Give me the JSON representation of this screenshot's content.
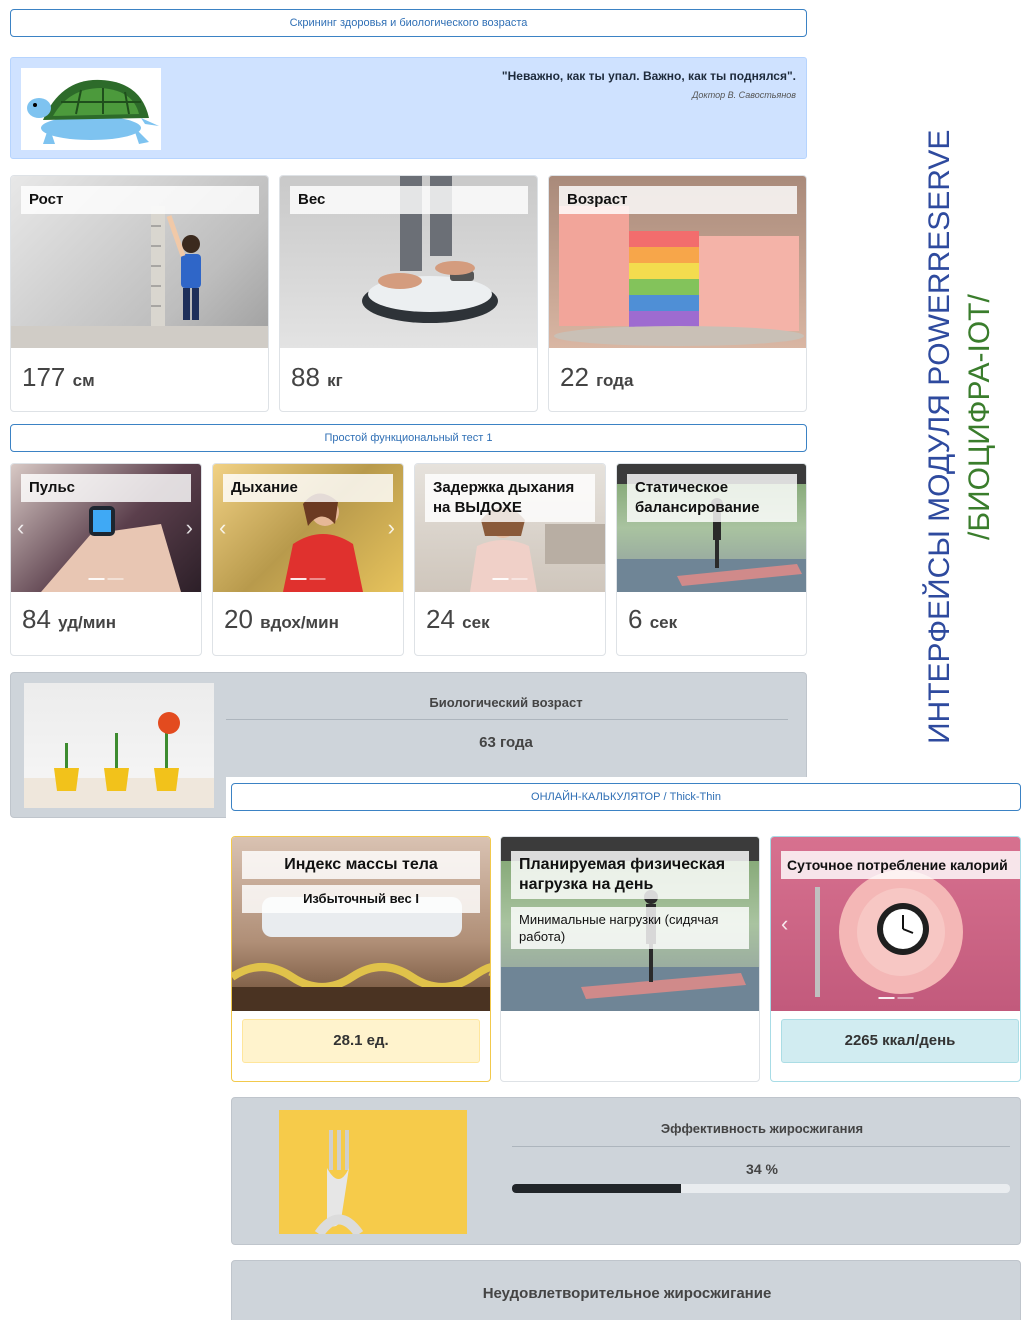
{
  "top_header": "Скрининг здоровья и биологического возраста",
  "quote": {
    "text": "\"Неважно, как ты упал. Важно, как ты поднялся\".",
    "author": "Доктор В. Савостьянов"
  },
  "metrics": [
    {
      "title": "Рост",
      "value": "177",
      "unit": "см"
    },
    {
      "title": "Вес",
      "value": "88",
      "unit": "кг"
    },
    {
      "title": "Возраст",
      "value": "22",
      "unit": "года"
    }
  ],
  "functional_header": "Простой функциональный тест 1",
  "tests": [
    {
      "title": "Пульс",
      "value": "84",
      "unit": "уд/мин"
    },
    {
      "title": "Дыхание",
      "value": "20",
      "unit": "вдох/мин"
    },
    {
      "title": "Задержка дыхания на ВЫДОХЕ",
      "value": "24",
      "unit": "сек"
    },
    {
      "title": "Статическое балансирование",
      "value": "6",
      "unit": "сек"
    }
  ],
  "bio_age": {
    "title": "Биологический возраст",
    "value": "63 года"
  },
  "calculator_header": "ОНЛАЙН-КАЛЬКУЛЯТОР / Thick-Thin",
  "bmi": {
    "title": "Индекс массы тела",
    "category": "Избыточный вес I",
    "value": "28.1",
    "unit": "ед."
  },
  "activity": {
    "title": "Планируемая физическая нагрузка на день",
    "level": "Минимальные нагрузки (сидячая работа)"
  },
  "calories": {
    "title": "Суточное потребление калорий",
    "value": "2265",
    "unit": "ккал/день"
  },
  "fat_burn": {
    "title": "Эффективность жиросжигания",
    "value_label": "34 %",
    "percent": 34
  },
  "fat_burn_verdict": "Неудовлетворительное жиросжигание",
  "side_title": {
    "line1": "ИНТЕРФЕЙСЫ МОДУЛЯ POWERRESERVE",
    "line2": "/БИОЦИФРА-IOT/"
  },
  "colors": {
    "side_line1": "#2e4a9e",
    "side_line2": "#3a7d2c",
    "progress": "#212529",
    "bmi_badge": "#fff3cd",
    "cal_badge": "#d1ecf1"
  }
}
